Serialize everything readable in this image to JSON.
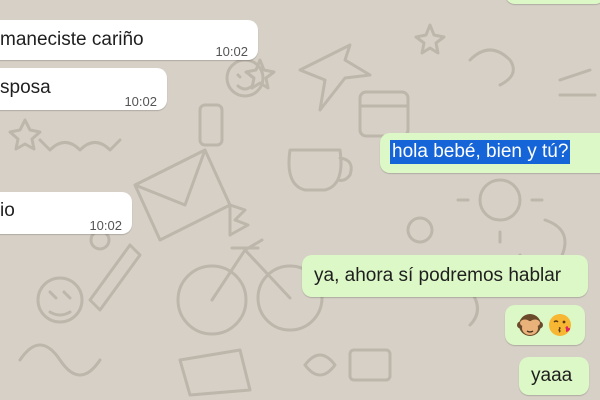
{
  "colors": {
    "wallpaper": "#d7d1c8",
    "incoming_bubble": "#ffffff",
    "outgoing_bubble": "#dcf8c6",
    "selection": "#1565d8"
  },
  "messages": [
    {
      "direction": "incoming",
      "text": "maneciste cariño",
      "time": "10:02"
    },
    {
      "direction": "incoming",
      "text": "sposa",
      "time": "10:02"
    },
    {
      "direction": "outgoing",
      "text": "hola bebé, bien y tú?",
      "selected": true
    },
    {
      "direction": "incoming",
      "text": "io",
      "time": "10:02"
    },
    {
      "direction": "outgoing",
      "text": "ya, ahora sí podremos hablar"
    },
    {
      "direction": "outgoing",
      "emojis": [
        "see-no-evil-monkey",
        "face-blowing-a-kiss"
      ]
    },
    {
      "direction": "outgoing",
      "text": "yaaa"
    }
  ]
}
